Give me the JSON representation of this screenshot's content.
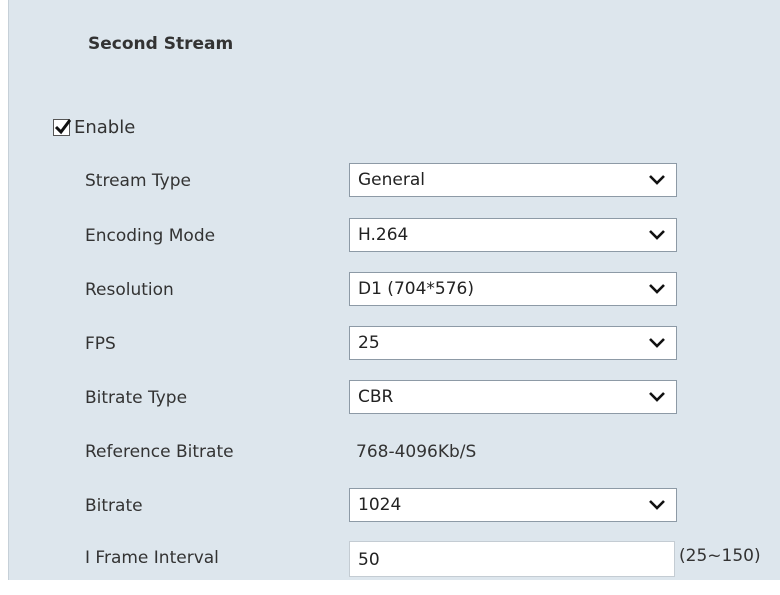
{
  "section": {
    "title": "Second Stream"
  },
  "enable": {
    "label": "Enable",
    "checked": true
  },
  "fields": {
    "stream_type": {
      "label": "Stream Type",
      "value": "General"
    },
    "encoding_mode": {
      "label": "Encoding Mode",
      "value": "H.264"
    },
    "resolution": {
      "label": "Resolution",
      "value": "D1 (704*576)"
    },
    "fps": {
      "label": "FPS",
      "value": "25"
    },
    "bitrate_type": {
      "label": "Bitrate Type",
      "value": "CBR"
    },
    "reference_bitrate": {
      "label": "Reference Bitrate",
      "value": "768-4096Kb/S"
    },
    "bitrate": {
      "label": "Bitrate",
      "value": "1024"
    },
    "i_frame_interval": {
      "label": "I Frame Interval",
      "value": "50",
      "range": "(25~150)"
    }
  },
  "icons": {
    "checkbox": "checkmark-icon",
    "dropdown": "chevron-down-icon"
  },
  "colors": {
    "panel_bg": "#dde6ed",
    "field_border": "#8d9aa6"
  }
}
